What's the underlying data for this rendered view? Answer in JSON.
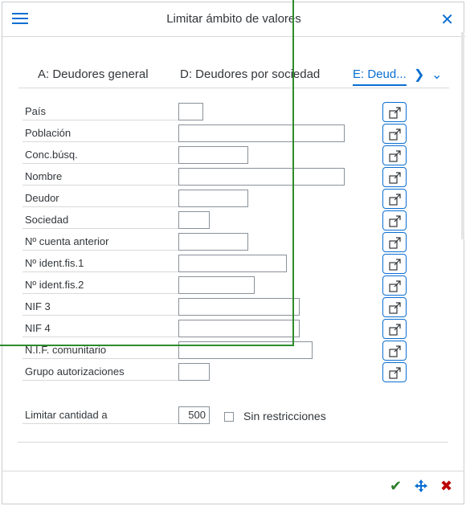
{
  "dialog": {
    "title": "Limitar ámbito de valores"
  },
  "tabs": [
    {
      "label": "A: Deudores general"
    },
    {
      "label": "D: Deudores por sociedad"
    },
    {
      "label": "E: Deud..."
    }
  ],
  "fields": [
    {
      "label": "País",
      "value": ""
    },
    {
      "label": "Población",
      "value": ""
    },
    {
      "label": "Conc.búsq.",
      "value": ""
    },
    {
      "label": "Nombre",
      "value": ""
    },
    {
      "label": "Deudor",
      "value": ""
    },
    {
      "label": "Sociedad",
      "value": ""
    },
    {
      "label": "Nº cuenta anterior",
      "value": ""
    },
    {
      "label": "Nº ident.fis.1",
      "value": ""
    },
    {
      "label": "Nº ident.fis.2",
      "value": ""
    },
    {
      "label": "NIF 3",
      "value": ""
    },
    {
      "label": "NIF 4",
      "value": ""
    },
    {
      "label": "N.I.F. comunitario",
      "value": ""
    },
    {
      "label": "Grupo autorizaciones",
      "value": ""
    }
  ],
  "limit": {
    "label": "Limitar cantidad a",
    "value": "500",
    "no_restrictions_label": "Sin restricciones",
    "no_restrictions_checked": false
  },
  "colors": {
    "accent": "#0a6ed1",
    "ok": "#2b7d2b",
    "cancel": "#bb0000"
  }
}
